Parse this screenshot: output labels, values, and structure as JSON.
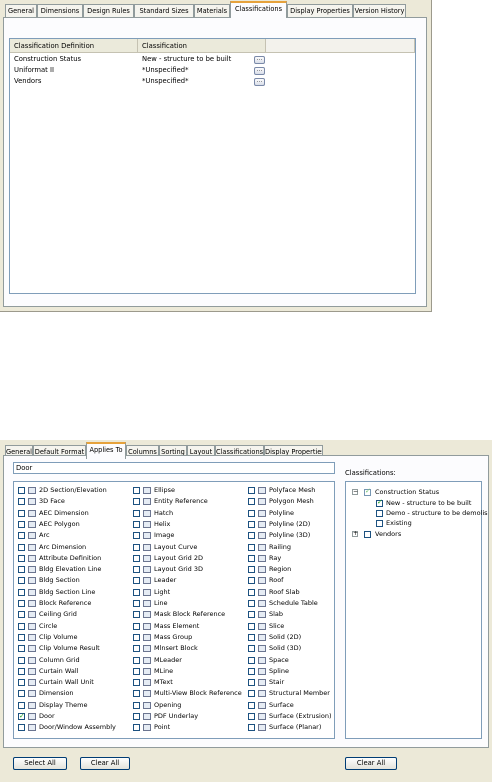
{
  "top_dialog": {
    "tabs": [
      "General",
      "Dimensions",
      "Design Rules",
      "Standard Sizes",
      "Materials",
      "Classifications",
      "Display Properties",
      "Version History"
    ],
    "active_tab": "Classifications",
    "grid_headers": [
      "Classification Definition",
      "Classification"
    ],
    "rows": [
      {
        "definition": "Construction Status",
        "classification": "New - structure to be built"
      },
      {
        "definition": "Uniformat II",
        "classification": "*Unspecified*"
      },
      {
        "definition": "Vendors",
        "classification": "*Unspecified*"
      }
    ]
  },
  "bottom_dialog": {
    "tabs": [
      "General",
      "Default Format",
      "Applies To",
      "Columns",
      "Sorting",
      "Layout",
      "Classifications",
      "Display Properties"
    ],
    "active_tab": "Applies To",
    "filter_value": "Door",
    "classifications_label": "Classifications:",
    "objects_col1": [
      {
        "label": "2D Section/Elevation",
        "checked": false
      },
      {
        "label": "3D Face",
        "checked": false
      },
      {
        "label": "AEC Dimension",
        "checked": false
      },
      {
        "label": "AEC Polygon",
        "checked": false
      },
      {
        "label": "Arc",
        "checked": false
      },
      {
        "label": "Arc Dimension",
        "checked": false
      },
      {
        "label": "Attribute Definition",
        "checked": false
      },
      {
        "label": "Bldg Elevation Line",
        "checked": false
      },
      {
        "label": "Bldg Section",
        "checked": false
      },
      {
        "label": "Bldg Section Line",
        "checked": false
      },
      {
        "label": "Block Reference",
        "checked": false
      },
      {
        "label": "Ceiling Grid",
        "checked": false
      },
      {
        "label": "Circle",
        "checked": false
      },
      {
        "label": "Clip Volume",
        "checked": false
      },
      {
        "label": "Clip Volume Result",
        "checked": false
      },
      {
        "label": "Column Grid",
        "checked": false
      },
      {
        "label": "Curtain Wall",
        "checked": false
      },
      {
        "label": "Curtain Wall Unit",
        "checked": false
      },
      {
        "label": "Dimension",
        "checked": false
      },
      {
        "label": "Display Theme",
        "checked": false
      },
      {
        "label": "Door",
        "checked": true
      },
      {
        "label": "Door/Window Assembly",
        "checked": false
      }
    ],
    "objects_col2": [
      {
        "label": "Ellipse",
        "checked": false
      },
      {
        "label": "Entity Reference",
        "checked": false
      },
      {
        "label": "Hatch",
        "checked": false
      },
      {
        "label": "Helix",
        "checked": false
      },
      {
        "label": "Image",
        "checked": false
      },
      {
        "label": "Layout Curve",
        "checked": false
      },
      {
        "label": "Layout Grid 2D",
        "checked": false
      },
      {
        "label": "Layout Grid 3D",
        "checked": false
      },
      {
        "label": "Leader",
        "checked": false
      },
      {
        "label": "Light",
        "checked": false
      },
      {
        "label": "Line",
        "checked": false
      },
      {
        "label": "Mask Block Reference",
        "checked": false
      },
      {
        "label": "Mass Element",
        "checked": false
      },
      {
        "label": "Mass Group",
        "checked": false
      },
      {
        "label": "Mlnsert Block",
        "checked": false
      },
      {
        "label": "MLeader",
        "checked": false
      },
      {
        "label": "MLine",
        "checked": false
      },
      {
        "label": "MText",
        "checked": false
      },
      {
        "label": "Multi-View Block Reference",
        "checked": false
      },
      {
        "label": "Opening",
        "checked": false
      },
      {
        "label": "PDF Underlay",
        "checked": false
      },
      {
        "label": "Point",
        "checked": false
      }
    ],
    "objects_col3": [
      {
        "label": "Polyface Mesh",
        "checked": false
      },
      {
        "label": "Polygon Mesh",
        "checked": false
      },
      {
        "label": "Polyline",
        "checked": false
      },
      {
        "label": "Polyline (2D)",
        "checked": false
      },
      {
        "label": "Polyline (3D)",
        "checked": false
      },
      {
        "label": "Railing",
        "checked": false
      },
      {
        "label": "Ray",
        "checked": false
      },
      {
        "label": "Region",
        "checked": false
      },
      {
        "label": "Roof",
        "checked": false
      },
      {
        "label": "Roof Slab",
        "checked": false
      },
      {
        "label": "Schedule Table",
        "checked": false
      },
      {
        "label": "Slab",
        "checked": false
      },
      {
        "label": "Slice",
        "checked": false
      },
      {
        "label": "Solid (2D)",
        "checked": false
      },
      {
        "label": "Solid (3D)",
        "checked": false
      },
      {
        "label": "Space",
        "checked": false
      },
      {
        "label": "Spline",
        "checked": false
      },
      {
        "label": "Stair",
        "checked": false
      },
      {
        "label": "Structural Member",
        "checked": false
      },
      {
        "label": "Surface",
        "checked": false
      },
      {
        "label": "Surface (Extrusion)",
        "checked": false
      },
      {
        "label": "Surface (Planar)",
        "checked": false
      }
    ],
    "tree": {
      "root": "Construction Status",
      "children": [
        "New - structure to be built",
        "Demo - structure to be demolis",
        "Existing"
      ],
      "checked_child": "New - structure to be built",
      "other_root": "Vendors"
    },
    "buttons": {
      "select_all": "Select All",
      "clear_all": "Clear All",
      "clear_all_right": "Clear All"
    }
  }
}
